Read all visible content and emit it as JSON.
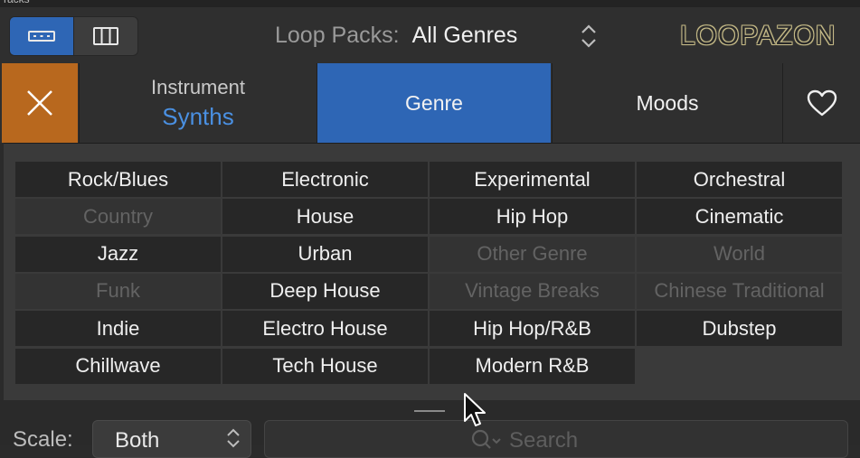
{
  "top_strip": {
    "text": "racks"
  },
  "toolbar": {
    "loop_packs_label": "Loop Packs:",
    "loop_packs_value": "All Genres",
    "logo": "LOOPAZON"
  },
  "tabs": {
    "instrument_label": "Instrument",
    "instrument_value": "Synths",
    "genre_label": "Genre",
    "moods_label": "Moods"
  },
  "genres": [
    {
      "label": "Rock/Blues",
      "enabled": true
    },
    {
      "label": "Electronic",
      "enabled": true
    },
    {
      "label": "Experimental",
      "enabled": true
    },
    {
      "label": "Orchestral",
      "enabled": true
    },
    {
      "label": "Country",
      "enabled": false
    },
    {
      "label": "House",
      "enabled": true
    },
    {
      "label": "Hip Hop",
      "enabled": true
    },
    {
      "label": "Cinematic",
      "enabled": true
    },
    {
      "label": "Jazz",
      "enabled": true
    },
    {
      "label": "Urban",
      "enabled": true
    },
    {
      "label": "Other Genre",
      "enabled": false
    },
    {
      "label": "World",
      "enabled": false
    },
    {
      "label": "Funk",
      "enabled": false
    },
    {
      "label": "Deep House",
      "enabled": true
    },
    {
      "label": "Vintage Breaks",
      "enabled": false
    },
    {
      "label": "Chinese Traditional",
      "enabled": false
    },
    {
      "label": "Indie",
      "enabled": true
    },
    {
      "label": "Electro House",
      "enabled": true
    },
    {
      "label": "Hip Hop/R&B",
      "enabled": true
    },
    {
      "label": "Dubstep",
      "enabled": true
    },
    {
      "label": "Chillwave",
      "enabled": true
    },
    {
      "label": "Tech House",
      "enabled": true
    },
    {
      "label": "Modern R&B",
      "enabled": true
    }
  ],
  "bottom": {
    "scale_label": "Scale:",
    "scale_value": "Both",
    "search_placeholder": "Search"
  },
  "colors": {
    "accent_blue": "#2e66b5",
    "close_orange": "#b8681e",
    "instrument_value_blue": "#4a90e2"
  },
  "icons": [
    "list-view-icon",
    "column-view-icon",
    "up-down-chevron-icon",
    "close-icon",
    "heart-icon",
    "search-icon",
    "mouse-pointer-icon"
  ]
}
